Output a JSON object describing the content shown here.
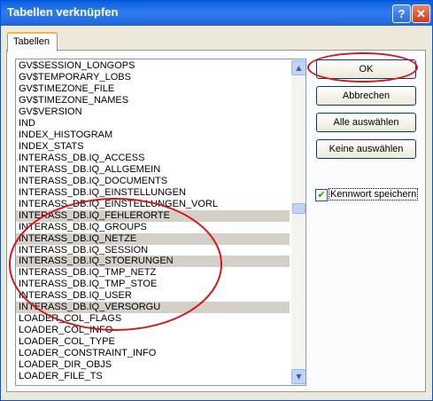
{
  "window": {
    "title": "Tabellen verknüpfen",
    "help_button": "?",
    "close_button": "✕"
  },
  "tabs": [
    {
      "label": "Tabellen"
    }
  ],
  "table_list": {
    "items": [
      "GV$SESSION_LONGOPS",
      "GV$TEMPORARY_LOBS",
      "GV$TIMEZONE_FILE",
      "GV$TIMEZONE_NAMES",
      "GV$VERSION",
      "IND",
      "INDEX_HISTOGRAM",
      "INDEX_STATS",
      "INTERASS_DB.IQ_ACCESS",
      "INTERASS_DB.IQ_ALLGEMEIN",
      "INTERASS_DB.IQ_DOCUMENTS",
      "INTERASS_DB.IQ_EINSTELLUNGEN",
      "INTERASS_DB.IQ_EINSTELLUNGEN_VORL",
      "INTERASS_DB.IQ_FEHLERORTE",
      "INTERASS_DB.IQ_GROUPS",
      "INTERASS_DB.IQ_NETZE",
      "INTERASS_DB.IQ_SESSION",
      "INTERASS_DB.IQ_STOERUNGEN",
      "INTERASS_DB.IQ_TMP_NETZ",
      "INTERASS_DB.IQ_TMP_STOE",
      "INTERASS_DB.IQ_USER",
      "INTERASS_DB.IQ_VERSORGU",
      "LOADER_COL_FLAGS",
      "LOADER_COL_INFO",
      "LOADER_COL_TYPE",
      "LOADER_CONSTRAINT_INFO",
      "LOADER_DIR_OBJS",
      "LOADER_FILE_TS"
    ],
    "selected": [
      "INTERASS_DB.IQ_FEHLERORTE",
      "INTERASS_DB.IQ_NETZE",
      "INTERASS_DB.IQ_STOERUNGEN",
      "INTERASS_DB.IQ_VERSORGU"
    ]
  },
  "buttons": {
    "ok": "OK",
    "cancel": "Abbrechen",
    "select_all": "Alle auswählen",
    "select_none": "Keine auswählen"
  },
  "save_password": {
    "label": "Kennwort speichern",
    "checked": true
  },
  "annotation_color": "#d2161c"
}
